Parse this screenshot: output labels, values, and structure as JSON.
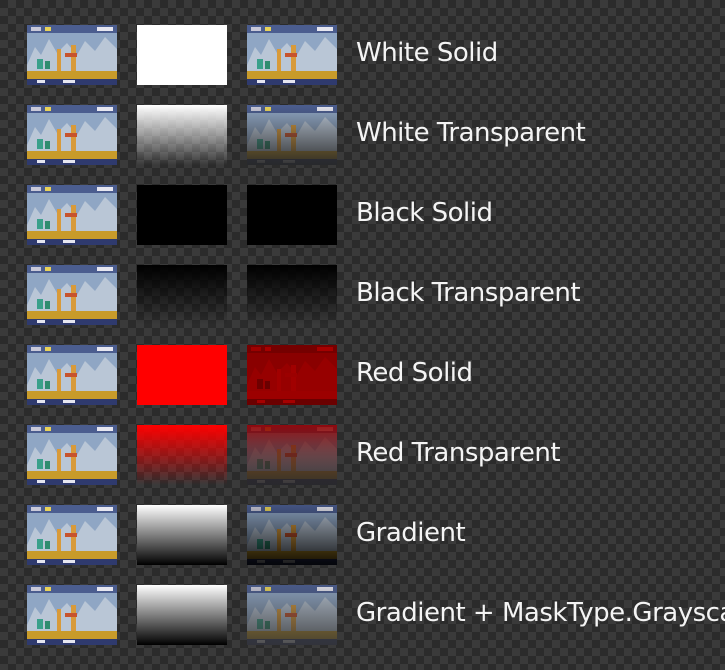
{
  "rows": [
    {
      "label": "White Solid"
    },
    {
      "label": "White Transparent"
    },
    {
      "label": "Black Solid"
    },
    {
      "label": "Black Transparent"
    },
    {
      "label": "Red Solid"
    },
    {
      "label": "Red Transparent"
    },
    {
      "label": "Gradient"
    },
    {
      "label": "Gradient + MaskType.Grayscale"
    }
  ],
  "colors": {
    "background_dark": "#2b2b2b",
    "background_light": "#3a3a3a",
    "white": "#ffffff",
    "black": "#000000",
    "red": "#ff0000"
  }
}
